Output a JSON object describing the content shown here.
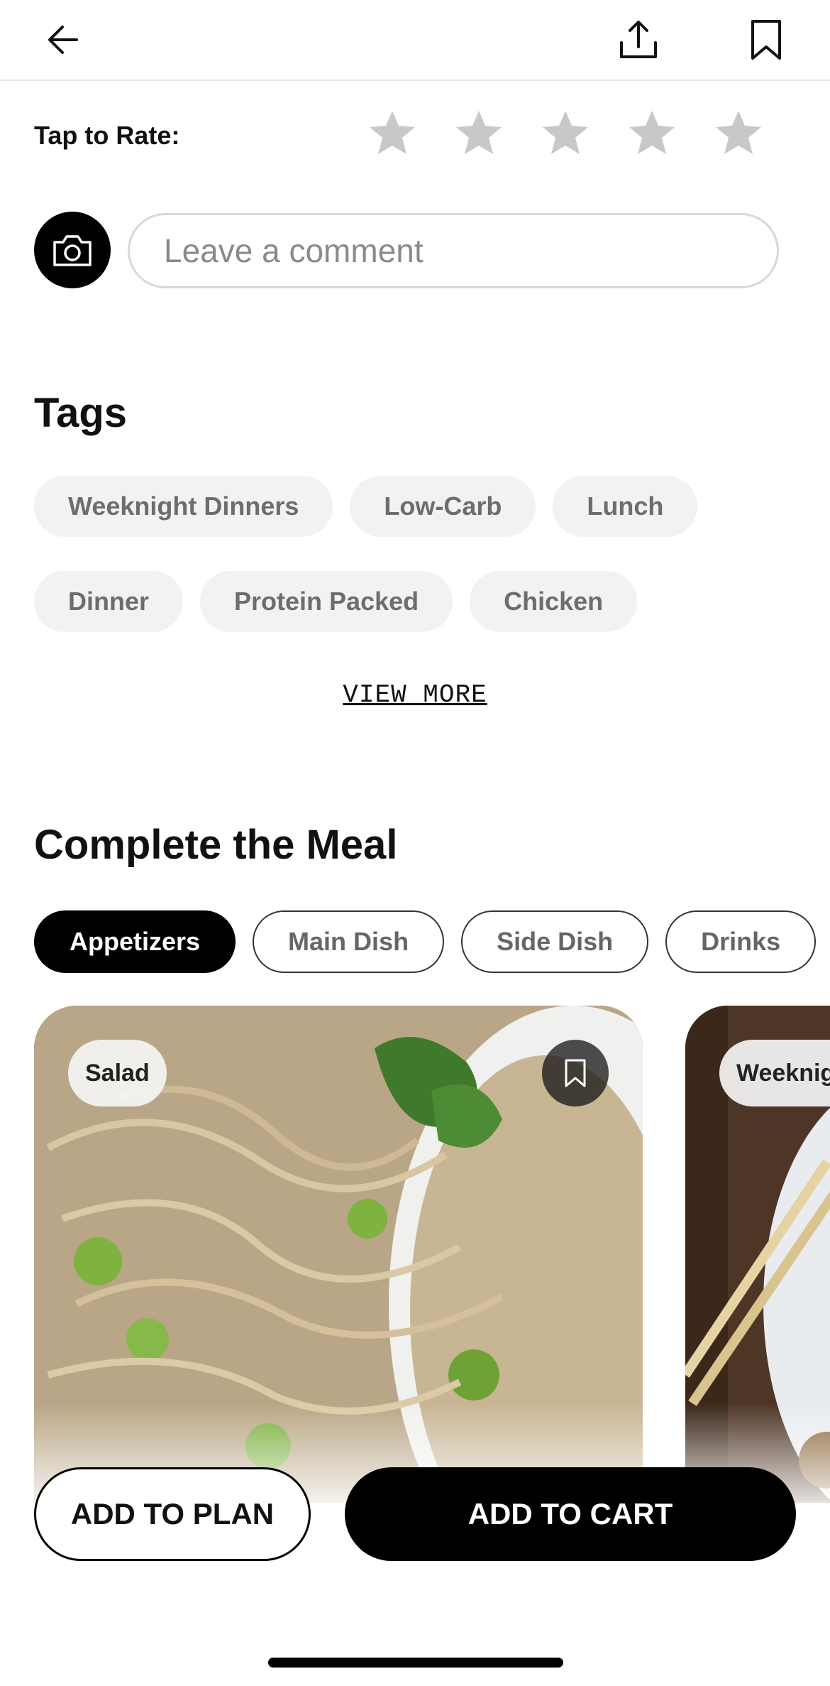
{
  "header": {
    "back_icon": "arrow-left-icon",
    "share_icon": "share-upload-icon",
    "bookmark_icon": "bookmark-icon"
  },
  "rating": {
    "label": "Tap to Rate:",
    "max_stars": 5,
    "current": 0,
    "star_color": "#c8c8c8"
  },
  "comment": {
    "camera_icon": "camera-icon",
    "placeholder": "Leave a comment",
    "value": ""
  },
  "tags": {
    "title": "Tags",
    "rows": [
      [
        "Weeknight Dinners",
        "Low-Carb",
        "Lunch"
      ],
      [
        "Dinner",
        "Protein Packed",
        "Chicken"
      ]
    ],
    "view_more": "VIEW MORE"
  },
  "meal": {
    "title": "Complete the Meal",
    "filters": [
      {
        "label": "Appetizers",
        "active": true
      },
      {
        "label": "Main Dish",
        "active": false
      },
      {
        "label": "Side Dish",
        "active": false
      },
      {
        "label": "Drinks",
        "active": false
      },
      {
        "label": "",
        "active": false
      }
    ],
    "cards": [
      {
        "badge": "Salad",
        "save_icon": "bookmark-icon"
      },
      {
        "badge": "Weeknig",
        "save_icon": "bookmark-icon"
      }
    ]
  },
  "actions": {
    "add_to_plan": "ADD TO PLAN",
    "add_to_cart": "ADD TO CART"
  },
  "colors": {
    "primary": "#000000",
    "tag_bg": "#f2f2f2",
    "tag_text": "#6d6d6d"
  }
}
